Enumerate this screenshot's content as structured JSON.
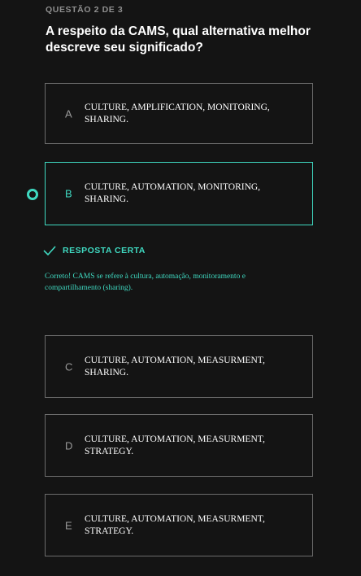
{
  "question": {
    "counter": "QUESTÃO 2 DE 3",
    "title": "A respeito da CAMS, qual alternativa melhor descreve seu significado?"
  },
  "options": [
    {
      "letter": "A",
      "text": "CULTURE, AMPLIFICATION, MONITORING, SHARING."
    },
    {
      "letter": "B",
      "text": "CULTURE, AUTOMATION, MONITORING, SHARING."
    },
    {
      "letter": "C",
      "text": "CULTURE, AUTOMATION, MEASURMENT, SHARING."
    },
    {
      "letter": "D",
      "text": "CULTURE, AUTOMATION, MEASURMENT, STRATEGY."
    },
    {
      "letter": "E",
      "text": "CULTURE, AUTOMATION, MEASURMENT, STRATEGY."
    }
  ],
  "selected_option": "B",
  "feedback": {
    "icon": "check-icon",
    "label": "RESPOSTA CERTA",
    "text": "Correto! CAMS se refere à cultura, automação, monitoramento e compartilhamento (sharing)."
  },
  "colors": {
    "background": "#141414",
    "accent": "#3fd9c1",
    "border": "#6c6c6c"
  }
}
